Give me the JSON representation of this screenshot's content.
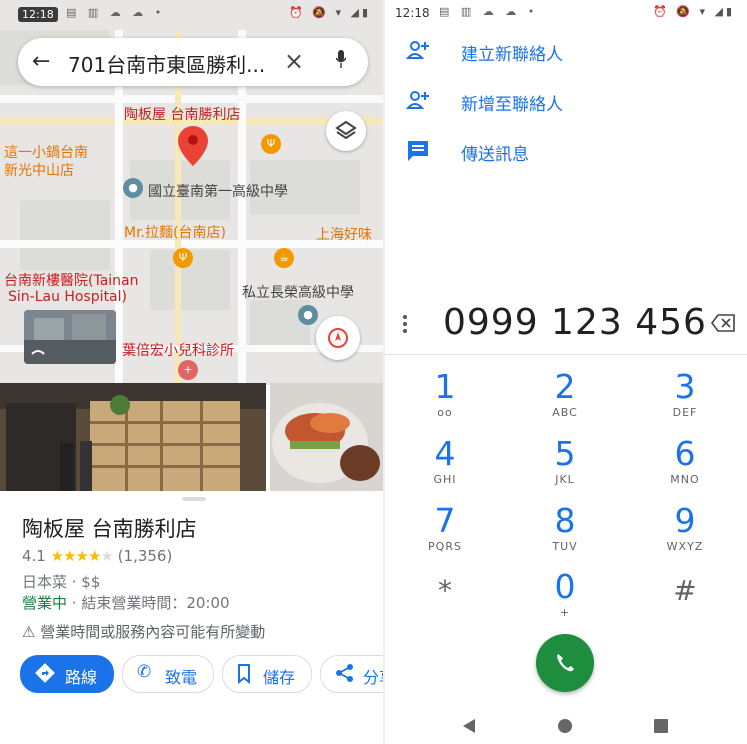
{
  "left": {
    "status": {
      "time": "12:18"
    },
    "search": {
      "query": "701台南市東區勝利..."
    },
    "map_labels": {
      "place_pin": "陶板屋 台南勝利店",
      "l1": "這一小鍋台南",
      "l2": "新光中山店",
      "school1": "國立臺南第一高級中學",
      "noodle": "Mr.拉麵(台南店)",
      "shanghai": "上海好味",
      "hospital1": "台南新樓醫院(Tainan",
      "hospital2": "Sin-Lau Hospital)",
      "school2": "私立長榮高級中學",
      "clinic": "葉倍宏小兒科診所"
    },
    "place": {
      "name": "陶板屋 台南勝利店",
      "rating": "4.1",
      "reviews": "(1,356)",
      "category": "日本菜 · $$",
      "open_status": "營業中",
      "hours": " · 結束營業時間：20:00",
      "warning": "營業時間或服務內容可能有所變動"
    },
    "actions": {
      "directions": "路線",
      "call": "致電",
      "save": "儲存",
      "share": "分享"
    }
  },
  "right": {
    "status": {
      "time": "12:18"
    },
    "menu": [
      {
        "label": "建立新聯絡人",
        "icon": "add-person-icon"
      },
      {
        "label": "新增至聯絡人",
        "icon": "add-person-icon"
      },
      {
        "label": "傳送訊息",
        "icon": "message-icon"
      }
    ],
    "number": "0999 123 456",
    "keys": [
      {
        "digit": "1",
        "letters": ""
      },
      {
        "digit": "2",
        "letters": "ABC"
      },
      {
        "digit": "3",
        "letters": "DEF"
      },
      {
        "digit": "4",
        "letters": "GHI"
      },
      {
        "digit": "5",
        "letters": "JKL"
      },
      {
        "digit": "6",
        "letters": "MNO"
      },
      {
        "digit": "7",
        "letters": "PQRS"
      },
      {
        "digit": "8",
        "letters": "TUV"
      },
      {
        "digit": "9",
        "letters": "WXYZ"
      },
      {
        "digit": "*",
        "letters": ""
      },
      {
        "digit": "0",
        "letters": "+"
      },
      {
        "digit": "#",
        "letters": ""
      }
    ]
  },
  "colors": {
    "accent": "#1a73e8",
    "call_green": "#1e8e3e",
    "open_green": "#188038",
    "pin_red": "#ea4335",
    "star": "#fbbc04"
  }
}
